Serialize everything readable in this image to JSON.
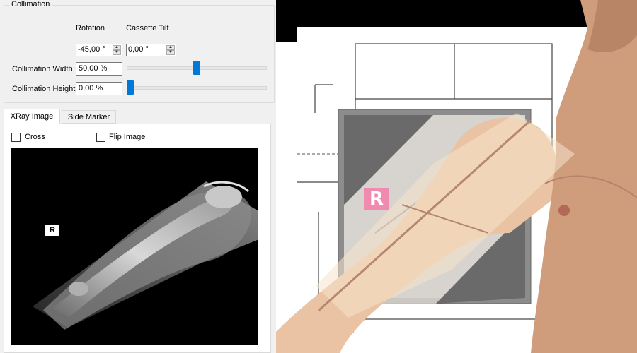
{
  "collimation": {
    "title": "Collimation",
    "rotation_label": "Rotation",
    "cassette_tilt_label": "Cassette Tilt",
    "rotation_value": "-45,00 °",
    "cassette_tilt_value": "0,00 °",
    "width_label": "Collimation Width",
    "width_value": "50,00 %",
    "width_slider_value": 0.5,
    "height_label": "Collimation Height",
    "height_value": "0,00 %",
    "height_slider_value": 0.0
  },
  "tabs": [
    {
      "label": "XRay Image",
      "active": true
    },
    {
      "label": "Side Marker",
      "active": false
    }
  ],
  "xray_tab": {
    "cross_label": "Cross",
    "cross_checked": false,
    "flip_label": "Flip Image",
    "flip_checked": false,
    "marker": "R"
  },
  "viewport": {
    "marker": "R",
    "marker_color": "#f08ab0"
  },
  "colors": {
    "slider_thumb": "#0078d7",
    "panel_bg": "#f0f0f0"
  }
}
